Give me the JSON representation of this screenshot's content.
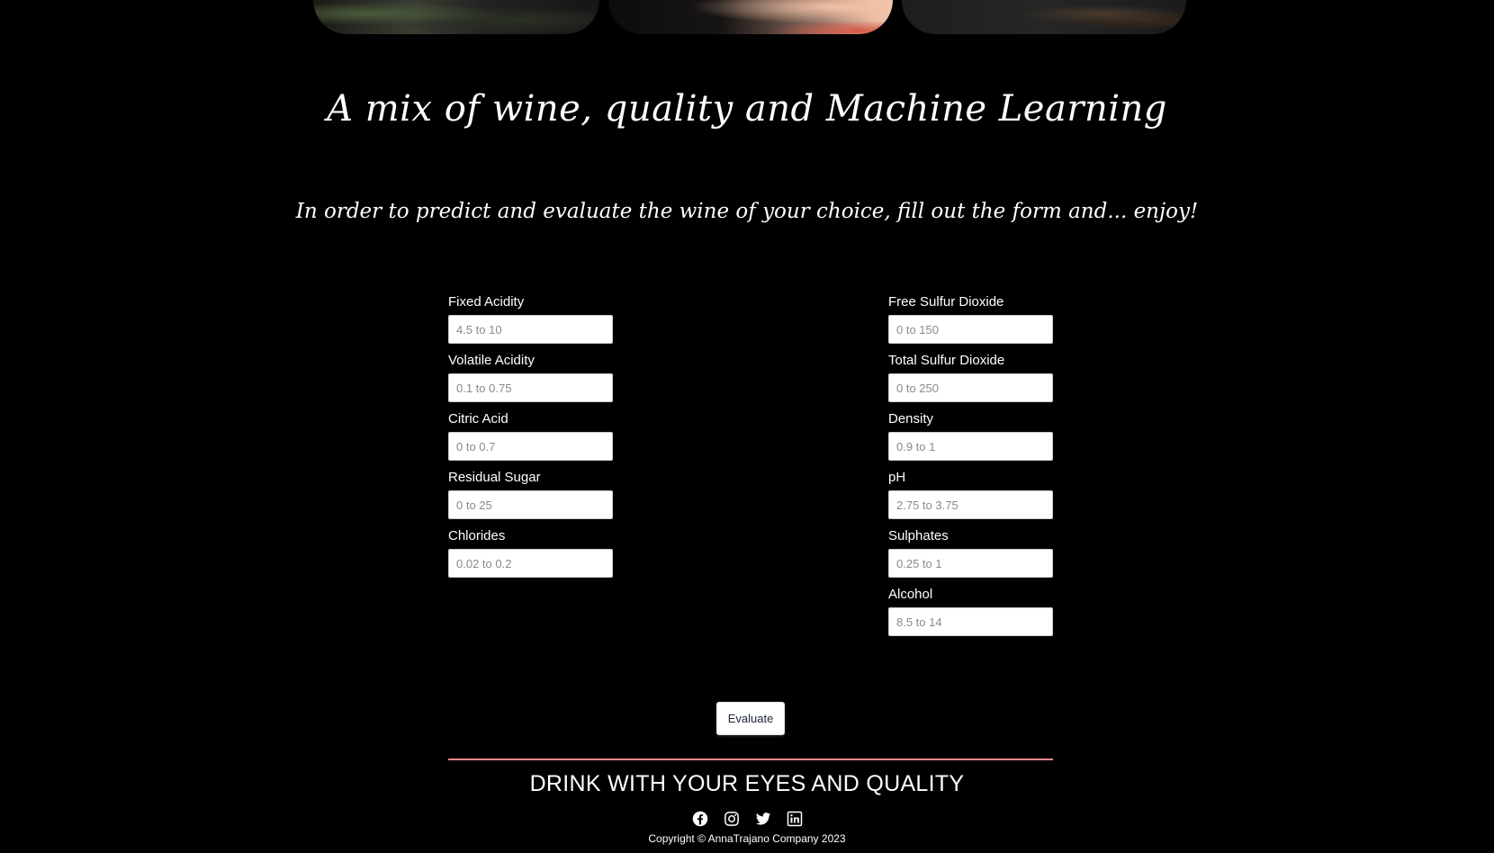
{
  "header": {
    "title": "A mix of wine, quality and Machine Learning",
    "subtitle": "In order to predict and evaluate the wine of your choice, fill out the form and... enjoy!"
  },
  "form": {
    "left": [
      {
        "label": "Fixed Acidity",
        "placeholder": "4.5 to 10"
      },
      {
        "label": "Volatile Acidity",
        "placeholder": "0.1 to 0.75"
      },
      {
        "label": "Citric Acid",
        "placeholder": "0 to 0.7"
      },
      {
        "label": "Residual Sugar",
        "placeholder": "0 to 25"
      },
      {
        "label": "Chlorides",
        "placeholder": "0.02 to 0.2"
      }
    ],
    "right": [
      {
        "label": "Free Sulfur Dioxide",
        "placeholder": "0 to 150"
      },
      {
        "label": "Total Sulfur Dioxide",
        "placeholder": "0 to 250"
      },
      {
        "label": "Density",
        "placeholder": "0.9 to 1"
      },
      {
        "label": "pH",
        "placeholder": "2.75 to 3.75"
      },
      {
        "label": "Sulphates",
        "placeholder": "0.25 to 1"
      },
      {
        "label": "Alcohol",
        "placeholder": "8.5 to 14"
      }
    ],
    "submit_label": "Evaluate"
  },
  "footer": {
    "slogan": "DRINK WITH YOUR EYES AND QUALITY",
    "socials": [
      "facebook-icon",
      "instagram-icon",
      "twitter-icon",
      "linkedin-icon"
    ],
    "copyright": "Copyright © AnnaTrajano Company 2023"
  },
  "colors": {
    "background": "#000000",
    "divider": "#e48a8a",
    "button_text": "#1a2438"
  }
}
